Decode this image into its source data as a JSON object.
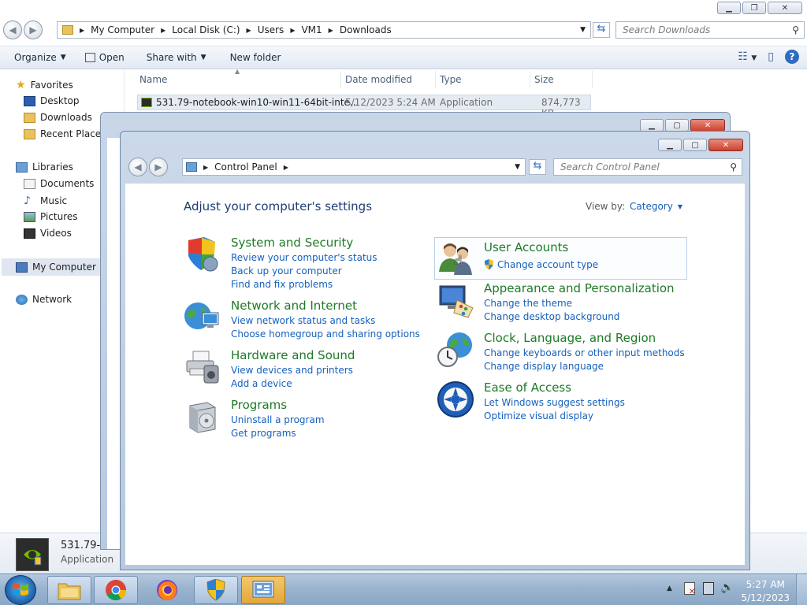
{
  "explorer": {
    "breadcrumb": [
      "My Computer",
      "Local Disk (C:)",
      "Users",
      "VM1",
      "Downloads"
    ],
    "search_placeholder": "Search Downloads",
    "toolbar": {
      "organize": "Organize",
      "open": "Open",
      "share_with": "Share with",
      "new_folder": "New folder"
    },
    "nav": {
      "favorites": "Favorites",
      "desktop": "Desktop",
      "downloads": "Downloads",
      "recent_places": "Recent Places",
      "libraries": "Libraries",
      "documents": "Documents",
      "music": "Music",
      "pictures": "Pictures",
      "videos": "Videos",
      "my_computer": "My Computer",
      "network": "Network"
    },
    "columns": {
      "name": "Name",
      "date_modified": "Date modified",
      "type": "Type",
      "size": "Size"
    },
    "files": [
      {
        "name": "531.79-notebook-win10-win11-64bit-inte...",
        "date": "5/12/2023 5:24 AM",
        "type": "Application",
        "size": "874,773 KB"
      }
    ],
    "details": {
      "name": "531.79-n",
      "type": "Application"
    }
  },
  "control_panel": {
    "breadcrumb": [
      "Control Panel"
    ],
    "search_placeholder": "Search Control Panel",
    "heading": "Adjust your computer's settings",
    "view_by_label": "View by:",
    "view_by_value": "Category",
    "categories_left": [
      {
        "title": "System and Security",
        "icon": "shield-icon",
        "links": [
          "Review your computer's status",
          "Back up your computer",
          "Find and fix problems"
        ]
      },
      {
        "title": "Network and Internet",
        "icon": "network-globe-icon",
        "links": [
          "View network status and tasks",
          "Choose homegroup and sharing options"
        ]
      },
      {
        "title": "Hardware and Sound",
        "icon": "printer-icon",
        "links": [
          "View devices and printers",
          "Add a device"
        ]
      },
      {
        "title": "Programs",
        "icon": "programs-box-icon",
        "links": [
          "Uninstall a program",
          "Get programs"
        ]
      }
    ],
    "categories_right": [
      {
        "title": "User Accounts",
        "icon": "users-icon",
        "links": [
          "Change account type"
        ]
      },
      {
        "title": "Appearance and Personalization",
        "icon": "monitor-palette-icon",
        "links": [
          "Change the theme",
          "Change desktop background"
        ]
      },
      {
        "title": "Clock, Language, and Region",
        "icon": "clock-globe-icon",
        "links": [
          "Change keyboards or other input methods",
          "Change display language"
        ]
      },
      {
        "title": "Ease of Access",
        "icon": "ease-of-access-icon",
        "links": [
          "Let Windows suggest settings",
          "Optimize visual display"
        ]
      }
    ]
  },
  "taskbar": {
    "apps": [
      "windows-explorer-icon",
      "chrome-icon",
      "firefox-icon",
      "security-shield-icon",
      "control-panel-icon"
    ],
    "clock_time": "5:27 AM",
    "clock_date": "5/12/2023"
  },
  "colors": {
    "link": "#1560bd",
    "category_title": "#1e7a28",
    "heading": "#1e3c78"
  }
}
